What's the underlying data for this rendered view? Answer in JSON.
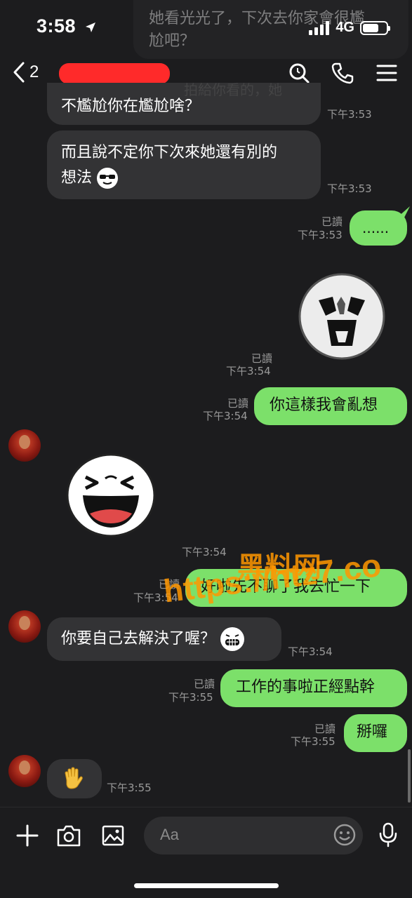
{
  "status_bar": {
    "time": "3:58",
    "network": "4G",
    "battery_level": 0.7
  },
  "header": {
    "back_count": "2"
  },
  "colors": {
    "accent_green": "#7ce06a",
    "incoming_bubble": "#333335",
    "background": "#1c1c1e"
  },
  "top_overlay": {
    "line1": "她看光光了，下次去你家會很尷",
    "line2": "尬吧？",
    "behind": "拍給你看的，她"
  },
  "messages": [
    {
      "dir": "in",
      "text": "不尷尬你在尷尬啥？",
      "time": "下午3:53"
    },
    {
      "dir": "in",
      "text_line1": "而且說不定你下次來她還有別的",
      "text_line2": "想法",
      "emoji": "sunglasses-face",
      "time": "下午3:53"
    },
    {
      "dir": "out",
      "text": "......",
      "read": "已讀",
      "time": "下午3:53"
    },
    {
      "dir": "out",
      "sticker": "shouting-face-sticker",
      "read": "已讀",
      "time": "下午3:54"
    },
    {
      "dir": "out",
      "text": "你這樣我會亂想",
      "read": "已讀",
      "time": "下午3:54"
    },
    {
      "dir": "in",
      "sticker": "laughing-face-sticker",
      "time": "下午3:54"
    },
    {
      "dir": "out",
      "text": "好啦先不聊了我去忙一下",
      "read": "已讀",
      "time": "下午3:54"
    },
    {
      "dir": "in",
      "text": "你要自己去解決了喔？",
      "emoji": "grinning-face",
      "time": "下午3:54"
    },
    {
      "dir": "out",
      "text": "工作的事啦正經點幹",
      "read": "已讀",
      "time": "下午3:55"
    },
    {
      "dir": "out",
      "text": "掰囉",
      "read": "已讀",
      "time": "下午3:55"
    },
    {
      "dir": "in",
      "emoji": "waving-hand",
      "time": "下午3:55"
    }
  ],
  "input": {
    "placeholder": "Aa"
  },
  "watermark": {
    "line1": "黑料网",
    "line2": "https://htz7.co"
  }
}
